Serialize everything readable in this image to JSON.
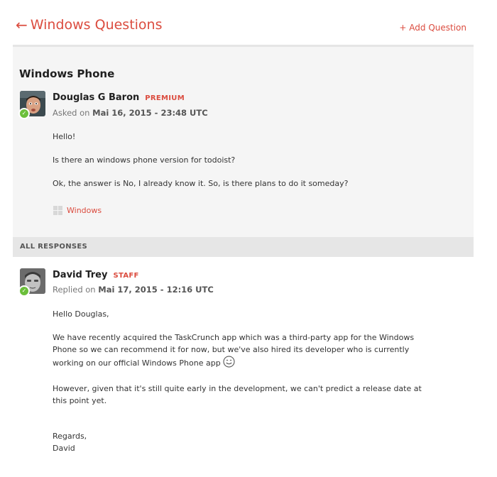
{
  "header": {
    "back_arrow": "←",
    "title": "Windows Questions",
    "add_question": "+ Add Question"
  },
  "question": {
    "title": "Windows Phone",
    "author": {
      "name": "Douglas G Baron",
      "badge": "PREMIUM",
      "verified_icon": "check-icon"
    },
    "meta": {
      "prefix": "Asked on ",
      "timestamp": "Mai 16, 2015 - 23:48 UTC"
    },
    "body": [
      "Hello!",
      "Is there an windows phone version for todoist?",
      "Ok, the answer is No, I already know it. So, is there plans to do it someday?"
    ],
    "tag": {
      "icon": "windows-logo-icon",
      "label": "Windows"
    }
  },
  "responses": {
    "section_label": "ALL RESPONSES",
    "items": [
      {
        "author": {
          "name": "David Trey",
          "badge": "STAFF",
          "verified_icon": "check-icon"
        },
        "meta": {
          "prefix": "Replied on ",
          "timestamp": "Mai 17, 2015 - 12:16 UTC"
        },
        "body": [
          "Hello Douglas,",
          "We have recently acquired the TaskCrunch app which was a third-party app for the Windows Phone so we can recommend it for now, but we've also hired its developer who is currently working on our official Windows Phone app",
          "However, given that it's still quite early in the development, we can't predict a release date at this point yet.",
          "Regards,",
          "David"
        ],
        "emoji_icon": "smiley-icon"
      }
    ]
  },
  "colors": {
    "accent": "#db4c3f",
    "verified": "#6bbf3a",
    "panel_bg": "#f5f5f5",
    "section_bg": "#e6e6e6"
  }
}
